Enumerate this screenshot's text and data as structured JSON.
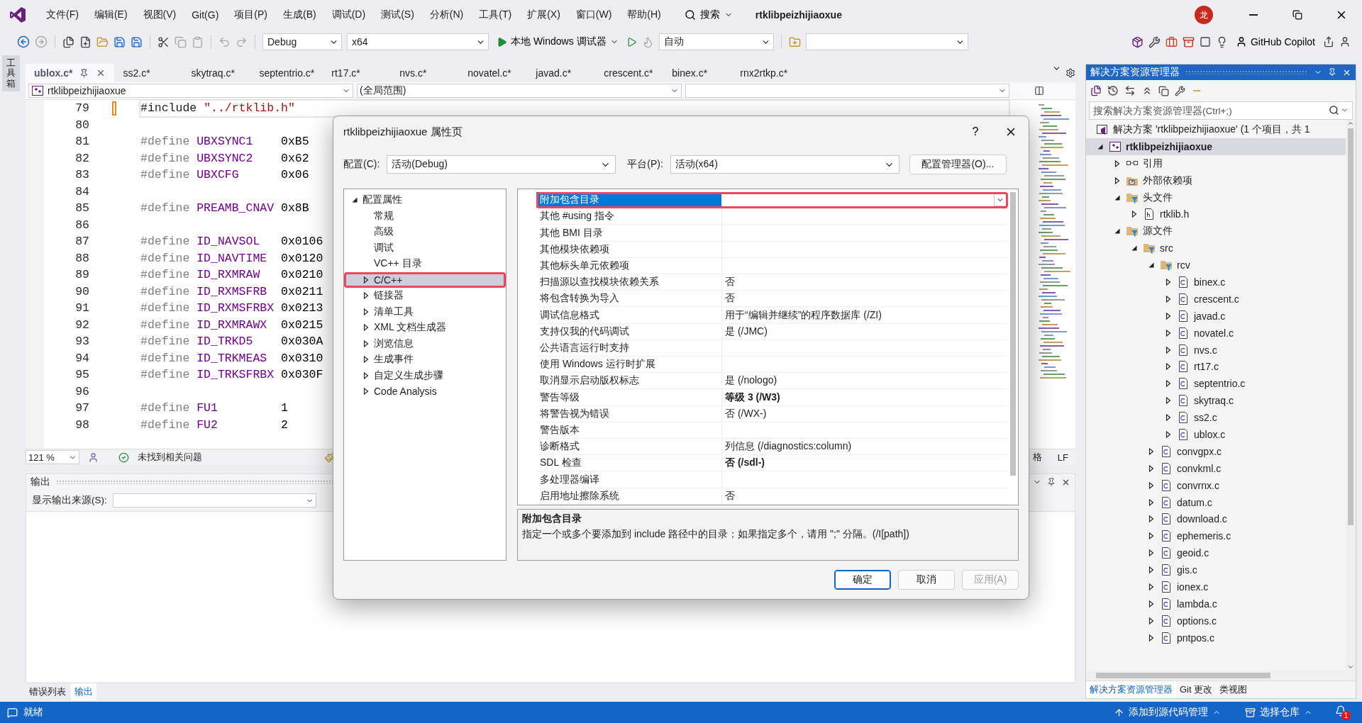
{
  "title_bar": {
    "menus": [
      "文件(F)",
      "编辑(E)",
      "视图(V)",
      "Git(G)",
      "项目(P)",
      "生成(B)",
      "调试(D)",
      "测试(S)",
      "分析(N)",
      "工具(T)",
      "扩展(X)",
      "窗口(W)",
      "帮助(H)"
    ],
    "search": "搜索",
    "solution_name": "rtklibpeizhijiaoxue",
    "avatar": "龙"
  },
  "toolbar": {
    "configuration": "Debug",
    "platform": "x64",
    "debugger": "本地 Windows 调试器",
    "target": "自动",
    "copilot": "GitHub Copilot"
  },
  "toolbox_label": "工具箱",
  "editor": {
    "tabs": [
      {
        "label": "ublox.c*",
        "selected": true
      },
      {
        "label": "ss2.c*",
        "selected": false
      },
      {
        "label": "skytraq.c*",
        "selected": false
      },
      {
        "label": "septentrio.c*",
        "selected": false
      },
      {
        "label": "rt17.c*",
        "selected": false
      },
      {
        "label": "nvs.c*",
        "selected": false
      },
      {
        "label": "novatel.c*",
        "selected": false
      },
      {
        "label": "javad.c*",
        "selected": false
      },
      {
        "label": "crescent.c*",
        "selected": false
      },
      {
        "label": "binex.c*",
        "selected": false
      },
      {
        "label": "rnx2rtkp.c*",
        "selected": false
      }
    ],
    "nav": {
      "project": "rtklibpeizhijiaoxue",
      "scope": "(全局范围)"
    },
    "lines": [
      {
        "number": "79",
        "kind": "include",
        "directive": "#include",
        "value": "\"../rtklib.h\"",
        "current": true
      },
      {
        "number": "80",
        "kind": "blank",
        "current": false
      },
      {
        "number": "81",
        "kind": "define",
        "directive": "#define",
        "name": "UBXSYNC1",
        "value": "0xB5",
        "current": false
      },
      {
        "number": "82",
        "kind": "define",
        "directive": "#define",
        "name": "UBXSYNC2",
        "value": "0x62",
        "current": false
      },
      {
        "number": "83",
        "kind": "define",
        "directive": "#define",
        "name": "UBXCFG",
        "value": "0x06",
        "current": false
      },
      {
        "number": "84",
        "kind": "blank",
        "current": false
      },
      {
        "number": "85",
        "kind": "define",
        "directive": "#define",
        "name": "PREAMB_CNAV",
        "value": "0x8B",
        "current": false
      },
      {
        "number": "86",
        "kind": "blank",
        "current": false
      },
      {
        "number": "87",
        "kind": "define",
        "directive": "#define",
        "name": "ID_NAVSOL",
        "value": "0x0106",
        "current": false
      },
      {
        "number": "88",
        "kind": "define",
        "directive": "#define",
        "name": "ID_NAVTIME",
        "value": "0x0120",
        "current": false
      },
      {
        "number": "89",
        "kind": "define",
        "directive": "#define",
        "name": "ID_RXMRAW",
        "value": "0x0210",
        "current": false
      },
      {
        "number": "90",
        "kind": "define",
        "directive": "#define",
        "name": "ID_RXMSFRB",
        "value": "0x0211",
        "current": false
      },
      {
        "number": "91",
        "kind": "define",
        "directive": "#define",
        "name": "ID_RXMSFRBX",
        "value": "0x0213",
        "current": false
      },
      {
        "number": "92",
        "kind": "define",
        "directive": "#define",
        "name": "ID_RXMRAWX",
        "value": "0x0215",
        "current": false
      },
      {
        "number": "93",
        "kind": "define",
        "directive": "#define",
        "name": "ID_TRKD5",
        "value": "0x030A",
        "current": false
      },
      {
        "number": "94",
        "kind": "define",
        "directive": "#define",
        "name": "ID_TRKMEAS",
        "value": "0x0310",
        "current": false
      },
      {
        "number": "95",
        "kind": "define",
        "directive": "#define",
        "name": "ID_TRKSFRBX",
        "value": "0x030F",
        "current": false
      },
      {
        "number": "96",
        "kind": "blank",
        "current": false
      },
      {
        "number": "97",
        "kind": "define",
        "directive": "#define",
        "name": "FU1",
        "value": "1",
        "current": false
      },
      {
        "number": "98",
        "kind": "define",
        "directive": "#define",
        "name": "FU2",
        "value": "2",
        "current": false
      }
    ],
    "zoom": "121 %",
    "issues": "未找到相关问题",
    "status_right": [
      "格",
      "LF"
    ]
  },
  "output": {
    "title": "输出",
    "source_label": "显示输出来源(S):"
  },
  "bottom_tabs": [
    {
      "label": "错误列表",
      "selected": false
    },
    {
      "label": "输出",
      "selected": true
    }
  ],
  "dialog": {
    "title": "rtklibpeizhijiaoxue 属性页",
    "help": "?",
    "config_label": "配置(C):",
    "config_value": "活动(Debug)",
    "platform_label": "平台(P):",
    "platform_value": "活动(x64)",
    "manager_button": "配置管理器(O)...",
    "tree": [
      {
        "label": "配置属性",
        "kind": "group",
        "expanded": true,
        "selected": false,
        "highlighted": false,
        "children": [
          {
            "label": "常规",
            "kind": "page",
            "selected": false,
            "highlighted": false
          },
          {
            "label": "高级",
            "kind": "page",
            "selected": false,
            "highlighted": false
          },
          {
            "label": "调试",
            "kind": "page",
            "selected": false,
            "highlighted": false
          },
          {
            "label": "VC++ 目录",
            "kind": "page",
            "selected": false,
            "highlighted": false
          },
          {
            "label": "C/C++",
            "kind": "group",
            "expanded": false,
            "selected": true,
            "highlighted": true
          },
          {
            "label": "链接器",
            "kind": "group",
            "expanded": false,
            "selected": false,
            "highlighted": false
          },
          {
            "label": "清单工具",
            "kind": "group",
            "expanded": false,
            "selected": false,
            "highlighted": false
          },
          {
            "label": "XML 文档生成器",
            "kind": "group",
            "expanded": false,
            "selected": false,
            "highlighted": false
          },
          {
            "label": "浏览信息",
            "kind": "group",
            "expanded": false,
            "selected": false,
            "highlighted": false
          },
          {
            "label": "生成事件",
            "kind": "group",
            "expanded": false,
            "selected": false,
            "highlighted": false
          },
          {
            "label": "自定义生成步骤",
            "kind": "group",
            "expanded": false,
            "selected": false,
            "highlighted": false
          },
          {
            "label": "Code Analysis",
            "kind": "group",
            "expanded": false,
            "selected": false,
            "highlighted": false
          }
        ]
      }
    ],
    "properties": [
      {
        "name": "附加包含目录",
        "selected": true,
        "highlighted": true
      },
      {
        "name": "其他 #using 指令",
        "selected": false,
        "highlighted": false
      },
      {
        "name": "其他 BMI 目录",
        "selected": false,
        "highlighted": false
      },
      {
        "name": "其他模块依赖项",
        "selected": false,
        "highlighted": false
      },
      {
        "name": "其他标头单元依赖项",
        "selected": false,
        "highlighted": false
      },
      {
        "name": "扫描源以查找模块依赖关系",
        "value": "否",
        "bold": false,
        "selected": false,
        "highlighted": false
      },
      {
        "name": "将包含转换为导入",
        "value": "否",
        "bold": false,
        "selected": false,
        "highlighted": false
      },
      {
        "name": "调试信息格式",
        "value": "用于“编辑并继续”的程序数据库 (/ZI)",
        "bold": false,
        "selected": false,
        "highlighted": false
      },
      {
        "name": "支持仅我的代码调试",
        "value": "是 (/JMC)",
        "bold": false,
        "selected": false,
        "highlighted": false
      },
      {
        "name": "公共语言运行时支持",
        "selected": false,
        "highlighted": false
      },
      {
        "name": "使用 Windows 运行时扩展",
        "selected": false,
        "highlighted": false
      },
      {
        "name": "取消显示启动版权标志",
        "value": "是 (/nologo)",
        "bold": false,
        "selected": false,
        "highlighted": false
      },
      {
        "name": "警告等级",
        "value": "等级 3 (/W3)",
        "bold": true,
        "selected": false,
        "highlighted": false
      },
      {
        "name": "将警告视为错误",
        "value": "否 (/WX-)",
        "bold": false,
        "selected": false,
        "highlighted": false
      },
      {
        "name": "警告版本",
        "selected": false,
        "highlighted": false
      },
      {
        "name": "诊断格式",
        "value": "列信息 (/diagnostics:column)",
        "bold": false,
        "selected": false,
        "highlighted": false
      },
      {
        "name": "SDL 检查",
        "value": "否 (/sdl-)",
        "bold": true,
        "selected": false,
        "highlighted": false
      },
      {
        "name": "多处理器编译",
        "selected": false,
        "highlighted": false
      },
      {
        "name": "启用地址擦除系统",
        "value": "否",
        "bold": false,
        "selected": false,
        "highlighted": false
      }
    ],
    "description": {
      "title": "附加包含目录",
      "text": "指定一个或多个要添加到 include 路径中的目录；如果指定多个，请用 \";\" 分隔。(/I[path])"
    },
    "buttons": [
      {
        "label": "确定",
        "kind": "primary",
        "disabled": false
      },
      {
        "label": "取消",
        "kind": "normal",
        "disabled": false
      },
      {
        "label": "应用(A)",
        "kind": "normal",
        "disabled": true
      }
    ]
  },
  "solution_explorer": {
    "title": "解决方案资源管理器",
    "search": {
      "placeholder": "搜索解决方案资源管理器(Ctrl+;)"
    },
    "tree": [
      {
        "label": "解决方案 'rtklibpeizhijiaoxue' (1 个项目，共 1",
        "kind": "solution",
        "selected": false
      },
      {
        "label": "rtklibpeizhijiaoxue",
        "kind": "project",
        "expanded": true,
        "selected": true,
        "children": [
          {
            "label": "引用",
            "kind": "references",
            "expanded": false,
            "selected": false
          },
          {
            "label": "外部依赖项",
            "kind": "external",
            "expanded": false,
            "selected": false
          },
          {
            "label": "头文件",
            "kind": "filter",
            "expanded": true,
            "selected": false,
            "children": [
              {
                "label": "rtklib.h",
                "kind": "header",
                "expanded": false,
                "selected": false
              }
            ]
          },
          {
            "label": "源文件",
            "kind": "filter",
            "expanded": true,
            "selected": false,
            "children": [
              {
                "label": "src",
                "kind": "filter",
                "expanded": true,
                "selected": false,
                "children": [
                  {
                    "label": "rcv",
                    "kind": "filter",
                    "expanded": true,
                    "selected": false,
                    "children": [
                      {
                        "label": "binex.c",
                        "kind": "source",
                        "expanded": false,
                        "selected": false
                      },
                      {
                        "label": "crescent.c",
                        "kind": "source",
                        "expanded": false,
                        "selected": false
                      },
                      {
                        "label": "javad.c",
                        "kind": "source",
                        "expanded": false,
                        "selected": false
                      },
                      {
                        "label": "novatel.c",
                        "kind": "source",
                        "expanded": false,
                        "selected": false
                      },
                      {
                        "label": "nvs.c",
                        "kind": "source",
                        "expanded": false,
                        "selected": false
                      },
                      {
                        "label": "rt17.c",
                        "kind": "source",
                        "expanded": false,
                        "selected": false
                      },
                      {
                        "label": "septentrio.c",
                        "kind": "source",
                        "expanded": false,
                        "selected": false
                      },
                      {
                        "label": "skytraq.c",
                        "kind": "source",
                        "expanded": false,
                        "selected": false
                      },
                      {
                        "label": "ss2.c",
                        "kind": "source",
                        "expanded": false,
                        "selected": false
                      },
                      {
                        "label": "ublox.c",
                        "kind": "source",
                        "expanded": false,
                        "selected": false
                      }
                    ]
                  },
                  {
                    "label": "convgpx.c",
                    "kind": "source",
                    "expanded": false,
                    "selected": false
                  },
                  {
                    "label": "convkml.c",
                    "kind": "source",
                    "expanded": false,
                    "selected": false
                  },
                  {
                    "label": "convrnx.c",
                    "kind": "source",
                    "expanded": false,
                    "selected": false
                  },
                  {
                    "label": "datum.c",
                    "kind": "source",
                    "expanded": false,
                    "selected": false
                  },
                  {
                    "label": "download.c",
                    "kind": "source",
                    "expanded": false,
                    "selected": false
                  },
                  {
                    "label": "ephemeris.c",
                    "kind": "source",
                    "expanded": false,
                    "selected": false
                  },
                  {
                    "label": "geoid.c",
                    "kind": "source",
                    "expanded": false,
                    "selected": false
                  },
                  {
                    "label": "gis.c",
                    "kind": "source",
                    "expanded": false,
                    "selected": false
                  },
                  {
                    "label": "ionex.c",
                    "kind": "source",
                    "expanded": false,
                    "selected": false
                  },
                  {
                    "label": "lambda.c",
                    "kind": "source",
                    "expanded": false,
                    "selected": false
                  },
                  {
                    "label": "options.c",
                    "kind": "source",
                    "expanded": false,
                    "selected": false
                  },
                  {
                    "label": "pntpos.c",
                    "kind": "source",
                    "expanded": false,
                    "selected": false
                  }
                ]
              }
            ]
          }
        ]
      }
    ],
    "tabs": [
      {
        "label": "解决方案资源管理器",
        "selected": true
      },
      {
        "label": "Git 更改",
        "selected": false
      },
      {
        "label": "类视图",
        "selected": false
      }
    ]
  },
  "status_bar": {
    "message": "就绪",
    "source_control": "添加到源代码管理",
    "repository": "选择仓库",
    "notifications": "1"
  }
}
